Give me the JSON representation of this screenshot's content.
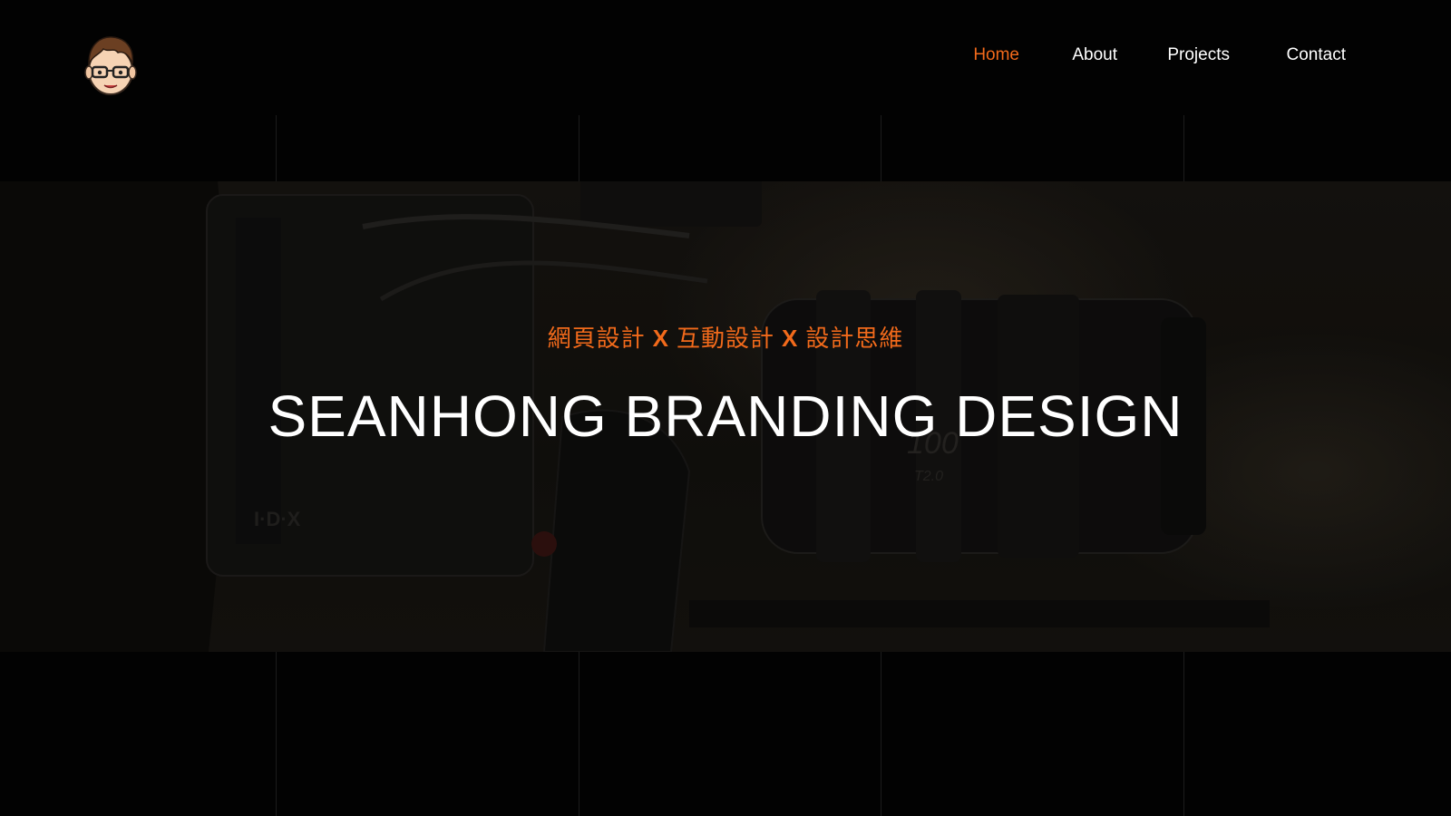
{
  "header": {
    "logo_icon": "cartoon-avatar-icon",
    "nav": [
      {
        "label": "Home",
        "active": true
      },
      {
        "label": "About",
        "active": false
      },
      {
        "label": "Projects",
        "active": false
      },
      {
        "label": "Contact",
        "active": false
      }
    ]
  },
  "hero": {
    "subtitle_parts": [
      "網頁設計",
      "X",
      "互動設計",
      "X",
      "設計思維"
    ],
    "title": "SEANHONG BRANDING DESIGN",
    "background_icon": "cinema-camera-photo"
  },
  "colors": {
    "accent": "#f26a1b",
    "background": "#020202",
    "text": "#ffffff"
  }
}
